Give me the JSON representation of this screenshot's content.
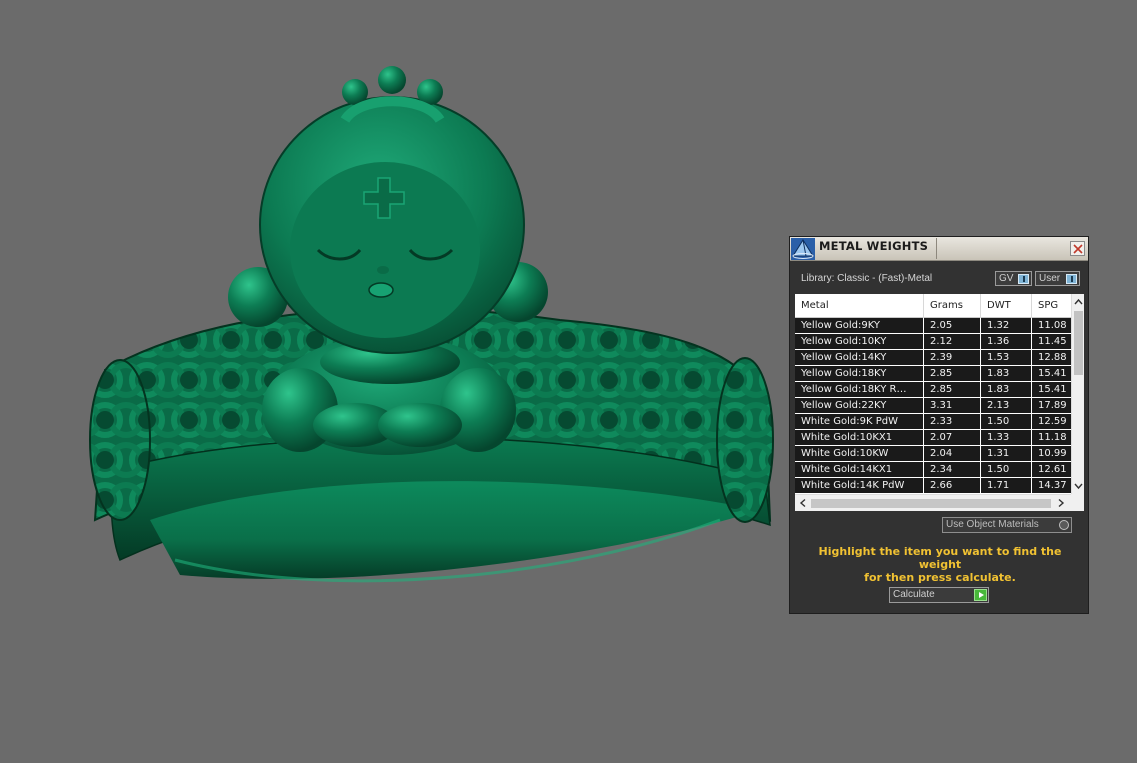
{
  "panel": {
    "title": "METAL WEIGHTS",
    "library_label": "Library: Classic - (Fast)-Metal",
    "toggles": {
      "gv_label": "GV",
      "user_label": "User"
    },
    "table": {
      "columns": [
        "Metal",
        "Grams",
        "DWT",
        "SPG"
      ],
      "rows": [
        [
          "Yellow Gold:9KY",
          "2.05",
          "1.32",
          "11.08"
        ],
        [
          "Yellow Gold:10KY",
          "2.12",
          "1.36",
          "11.45"
        ],
        [
          "Yellow Gold:14KY",
          "2.39",
          "1.53",
          "12.88"
        ],
        [
          "Yellow Gold:18KY",
          "2.85",
          "1.83",
          "15.41"
        ],
        [
          "Yellow Gold:18KY R…",
          "2.85",
          "1.83",
          "15.41"
        ],
        [
          "Yellow Gold:22KY",
          "3.31",
          "2.13",
          "17.89"
        ],
        [
          "White Gold:9K PdW",
          "2.33",
          "1.50",
          "12.59"
        ],
        [
          "White Gold:10KX1",
          "2.07",
          "1.33",
          "11.18"
        ],
        [
          "White Gold:10KW",
          "2.04",
          "1.31",
          "10.99"
        ],
        [
          "White Gold:14KX1",
          "2.34",
          "1.50",
          "12.61"
        ],
        [
          "White Gold:14K PdW",
          "2.66",
          "1.71",
          "14.37"
        ]
      ]
    },
    "use_object_materials": "Use Object Materials",
    "hint_line1": "Highlight the item you want to find the weight",
    "hint_line2": "for then press calculate.",
    "calculate_label": "Calculate"
  },
  "colors": {
    "viewport_background": "#6b6b6b",
    "model_green": "#0e7a52",
    "panel_background": "#323232",
    "hint_text": "#f1c232",
    "go_button": "#48b83a"
  },
  "icons": {
    "app": "pyramid-app-icon",
    "close": "close-icon",
    "calculate": "play-arrow-icon"
  }
}
